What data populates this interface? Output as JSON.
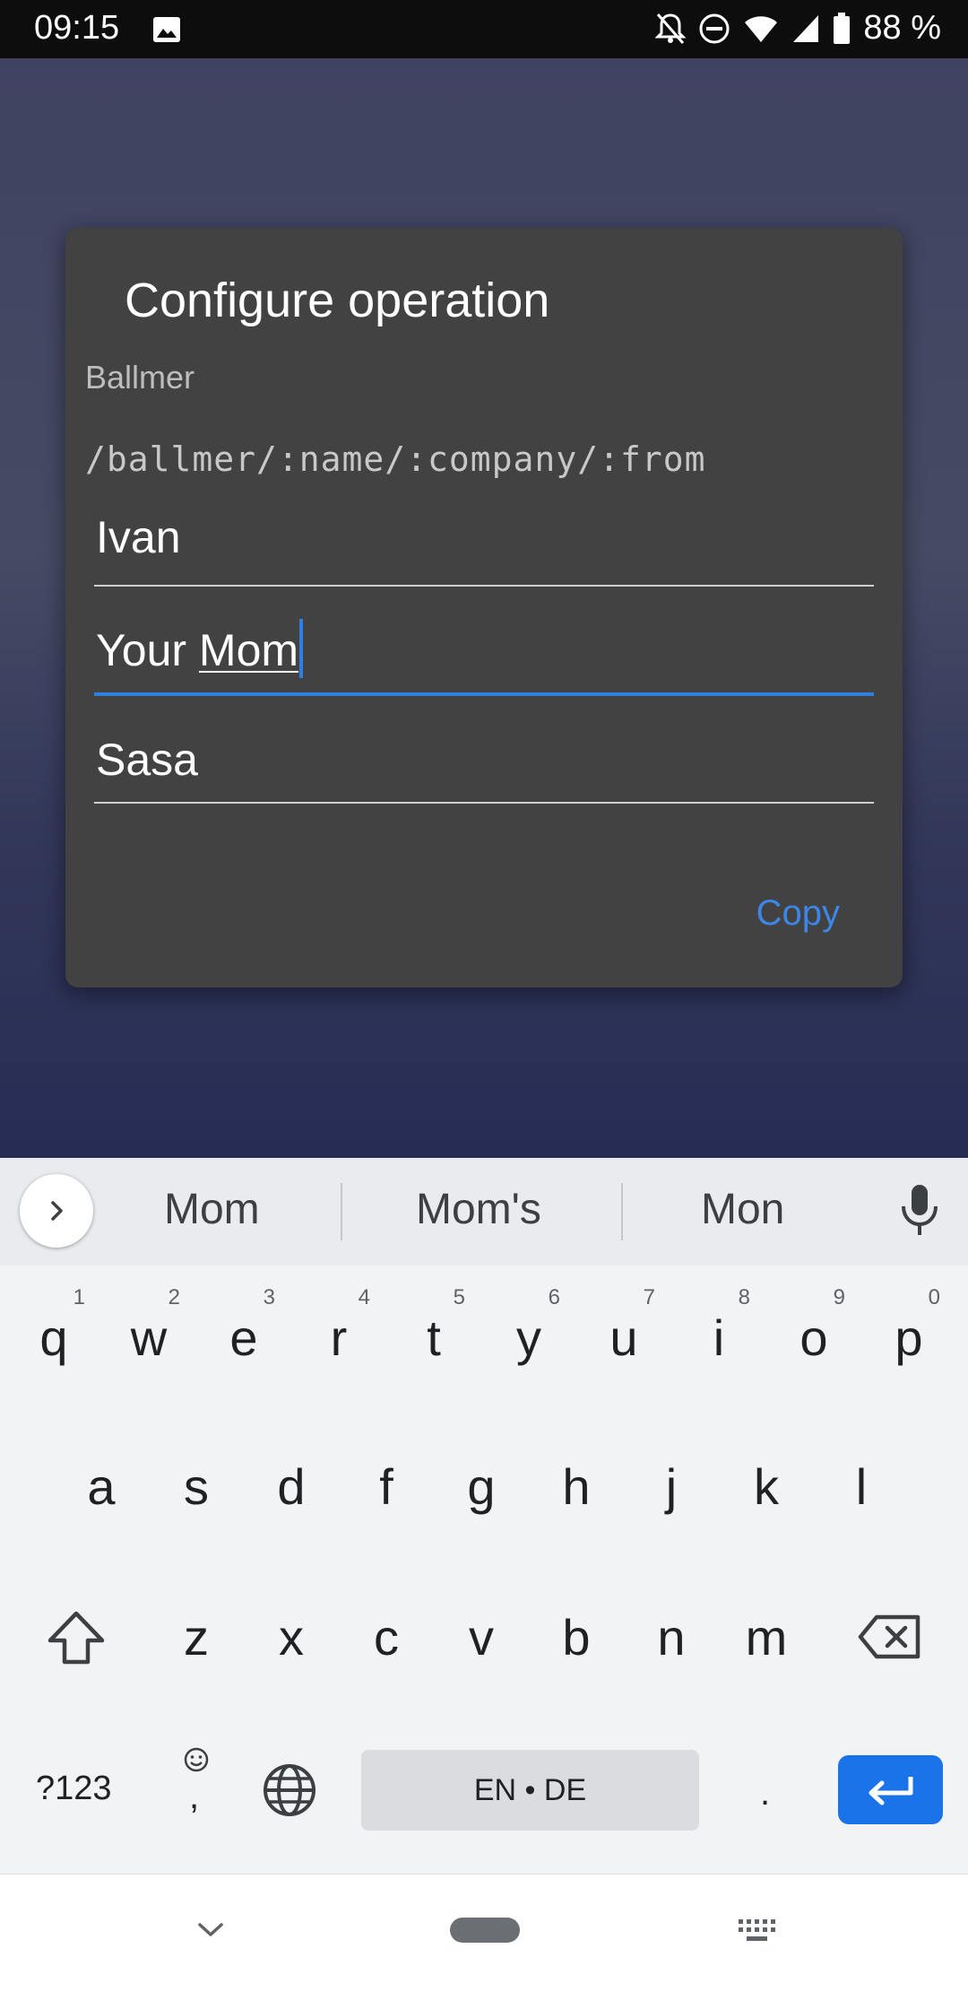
{
  "status_bar": {
    "time": "09:15",
    "battery": "88 %",
    "icons": [
      "image-icon",
      "notifications-off-icon",
      "do-not-disturb-icon",
      "wifi-icon",
      "signal-icon",
      "battery-icon"
    ]
  },
  "dialog": {
    "title": "Configure operation",
    "subtitle": "Ballmer",
    "path": "/ballmer/:name/:company/:from",
    "fields": [
      {
        "value": "Ivan"
      },
      {
        "prefix": "Your ",
        "composing": "Mom"
      },
      {
        "value": "Sasa"
      }
    ],
    "copy_label": "Copy",
    "accent": "#2f7fe0"
  },
  "keyboard": {
    "suggestions": [
      "Mom",
      "Mom's",
      "Mon"
    ],
    "row1": [
      [
        "q",
        "1"
      ],
      [
        "w",
        "2"
      ],
      [
        "e",
        "3"
      ],
      [
        "r",
        "4"
      ],
      [
        "t",
        "5"
      ],
      [
        "y",
        "6"
      ],
      [
        "u",
        "7"
      ],
      [
        "i",
        "8"
      ],
      [
        "o",
        "9"
      ],
      [
        "p",
        "0"
      ]
    ],
    "row2": [
      "a",
      "s",
      "d",
      "f",
      "g",
      "h",
      "j",
      "k",
      "l"
    ],
    "row3": [
      "z",
      "x",
      "c",
      "v",
      "b",
      "n",
      "m"
    ],
    "symbols_label": "?123",
    "comma_label": ",",
    "space_label": "EN • DE",
    "period_label": ".",
    "enter_color": "#1a73e8"
  }
}
